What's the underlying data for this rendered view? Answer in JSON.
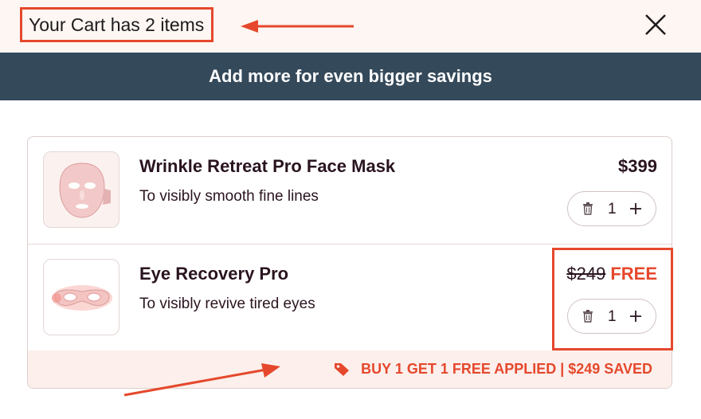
{
  "header": {
    "cart_title": "Your Cart has 2 items",
    "close_icon": "close-icon"
  },
  "banner": {
    "text": "Add more for even bigger savings"
  },
  "cart": {
    "items": [
      {
        "name": "Wrinkle Retreat Pro Face Mask",
        "description": "To visibly smooth fine lines",
        "price": "$399",
        "quantity": "1",
        "image": "face-mask"
      },
      {
        "name": "Eye Recovery Pro",
        "description": "To visibly revive tired eyes",
        "original_price": "$249",
        "price": "FREE",
        "quantity": "1",
        "image": "eye-mask"
      }
    ],
    "promo": {
      "text": "BUY 1 GET 1 FREE APPLIED | $249 SAVED",
      "icon": "tag-icon"
    }
  },
  "colors": {
    "accent": "#e5482c",
    "banner_bg": "#34495a",
    "header_bg": "#fdf6f2",
    "promo_bg": "#fcefec"
  }
}
